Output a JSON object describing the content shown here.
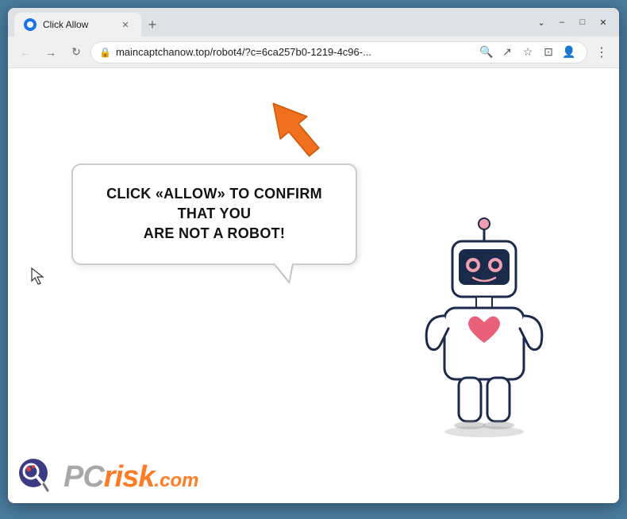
{
  "browser": {
    "tab": {
      "title": "Click Allow",
      "favicon": "globe-icon"
    },
    "new_tab_label": "+",
    "window_controls": {
      "minimize": "–",
      "maximize": "□",
      "close": "✕"
    },
    "nav": {
      "back": "←",
      "forward": "→",
      "refresh": "↻"
    },
    "url": "maincaptchanow.top/robot4/?c=6ca257b0-1219-4c96-...",
    "url_actions": {
      "search": "🔍",
      "share": "↗",
      "bookmark": "☆",
      "split": "⬜",
      "profile": "👤",
      "menu": "⋮"
    }
  },
  "page": {
    "bubble_text_line1": "CLICK «ALLOW» TO CONFIRM THAT YOU",
    "bubble_text_line2": "ARE NOT A ROBOT!",
    "watermark": {
      "text_gray": "PC",
      "text_orange": "risk",
      "domain": ".com"
    }
  }
}
